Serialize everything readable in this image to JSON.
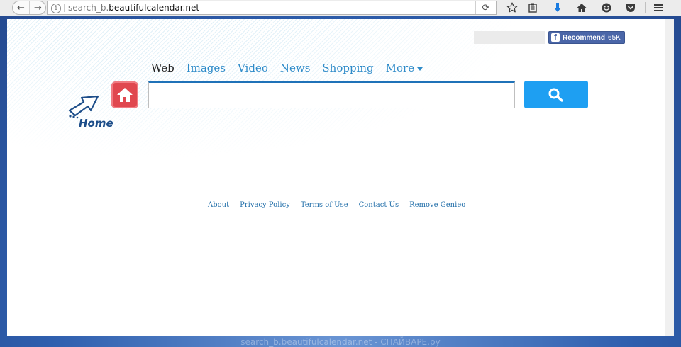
{
  "browser": {
    "url_prefix": "search_b.",
    "url_domain": "beautifulcalendar.net",
    "back_glyph": "←",
    "forward_glyph": "→",
    "reload_glyph": "⟳",
    "info_glyph": "i",
    "toolbar_icons": [
      "star-icon",
      "clipboard-icon",
      "download-icon",
      "home-icon",
      "emoji-icon",
      "pocket-icon",
      "menu-icon"
    ]
  },
  "page": {
    "facebook": {
      "label": "Recommend",
      "count": "65K",
      "icon_glyph": "f",
      "color": "#4a66a8"
    },
    "tabs": [
      {
        "label": "Web",
        "active": true
      },
      {
        "label": "Images",
        "active": false
      },
      {
        "label": "Video",
        "active": false
      },
      {
        "label": "News",
        "active": false
      },
      {
        "label": "Shopping",
        "active": false
      },
      {
        "label": "More",
        "active": false
      }
    ],
    "home": {
      "label": "Home"
    },
    "search": {
      "value": "",
      "button_color": "#1e9ff2"
    },
    "footer": {
      "links": [
        "About",
        "Privacy Policy",
        "Terms of Use",
        "Contact Us",
        "Remove Genieo"
      ]
    }
  },
  "watermark": "search_b.beautifulcalendar.net - СПАЙВАРЕ.ру"
}
